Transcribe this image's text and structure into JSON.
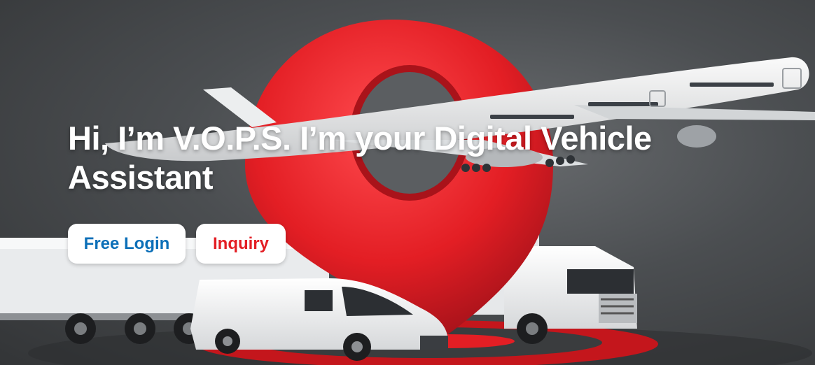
{
  "hero": {
    "headline": "Hi, I’m V.O.P.S. I’m your Digital Vehicle Assistant",
    "buttons": {
      "login_label": "Free Login",
      "inquiry_label": "Inquiry"
    }
  },
  "colors": {
    "login_text": "#0b6fb8",
    "inquiry_text": "#e31e24",
    "pin_red": "#e31e24",
    "background": "#4b4e51"
  }
}
